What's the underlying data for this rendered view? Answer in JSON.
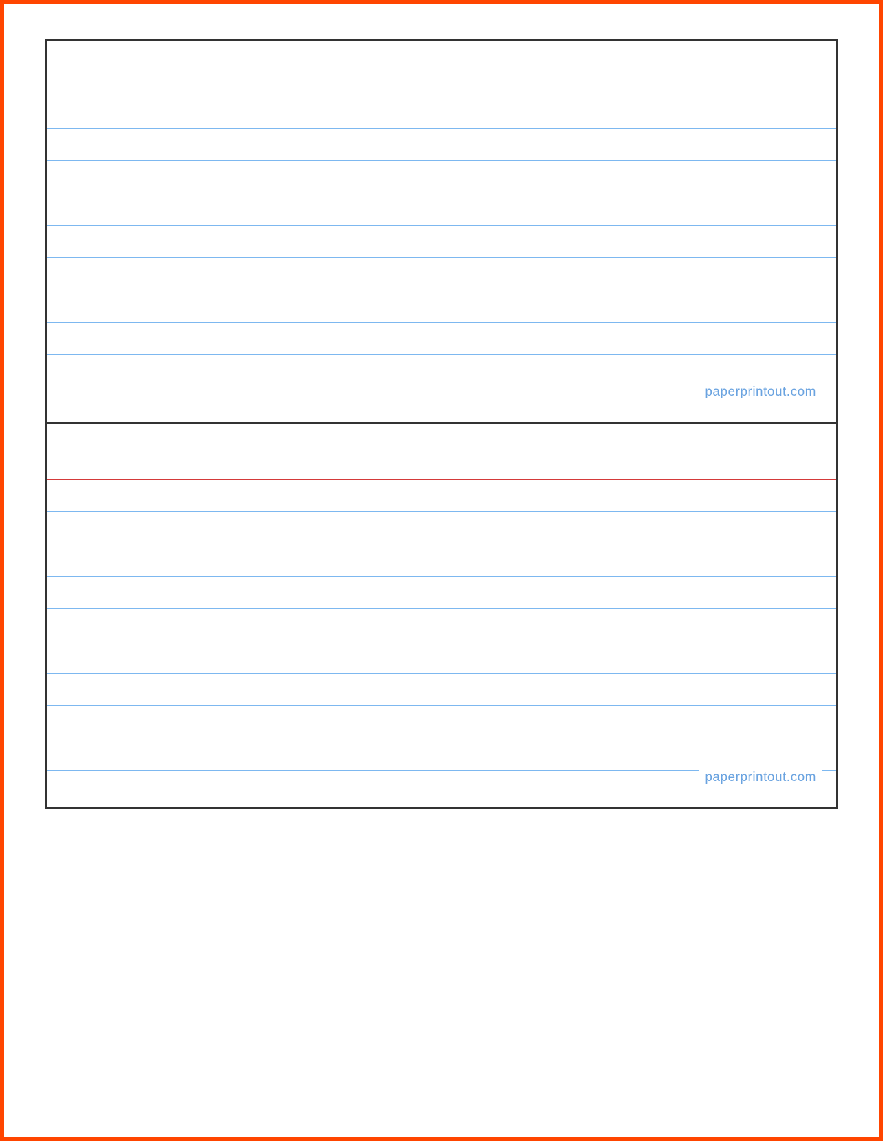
{
  "cards": [
    {
      "watermark": "paperprintout.com",
      "blue_line_count": 9
    },
    {
      "watermark": "paperprintout.com",
      "blue_line_count": 9
    }
  ]
}
